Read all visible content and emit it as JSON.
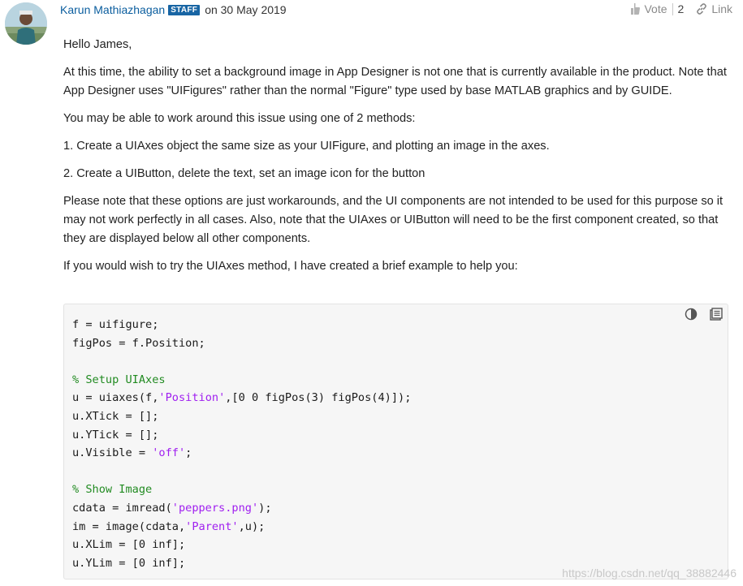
{
  "post": {
    "author": "Karun Mathiazhagan",
    "badge": "STAFF",
    "date": "on 30 May 2019",
    "vote_label": "Vote",
    "vote_count": "2",
    "link_label": "Link"
  },
  "paragraphs": {
    "p1": "Hello James,",
    "p2": "At this time, the ability to set a background image in App Designer is not one that is currently available in the product. Note that App Designer uses \"UIFigures\" rather than the normal \"Figure\" type used by base MATLAB graphics and by GUIDE.",
    "p3": "You may be able to work around this issue using one of 2 methods:",
    "p4": "1. Create a UIAxes object the same size as your UIFigure, and plotting an image in the axes.",
    "p5": "2. Create a UIButton, delete the text, set an image icon for the button",
    "p6": "Please note that these options are just workarounds, and the UI components are not intended to be used for this purpose so it may not work perfectly in all cases. Also, note that the UIAxes or UIButton will need to be the first component created, so that they are displayed below all other components.",
    "p7": "If you would wish to try the UIAxes method, I have created a brief example to help you:"
  },
  "code": {
    "l1": "f = uifigure;",
    "l2": "figPos = f.Position;",
    "l4": "% Setup UIAxes",
    "l5a": "u = uiaxes(f,",
    "l5b": "'Position'",
    "l5c": ",[0 0 figPos(3) figPos(4)]);",
    "l6": "u.XTick = [];",
    "l7": "u.YTick = [];",
    "l8a": "u.Visible = ",
    "l8b": "'off'",
    "l8c": ";",
    "l10": "% Show Image",
    "l11a": "cdata = imread(",
    "l11b": "'peppers.png'",
    "l11c": ");",
    "l12a": "im = image(cdata,",
    "l12b": "'Parent'",
    "l12c": ",u);",
    "l13": "u.XLim = [0 inf];",
    "l14": "u.YLim = [0 inf];"
  },
  "watermark": "https://blog.csdn.net/qq_38882446",
  "icons": {
    "vote": "thumbs-up-icon",
    "link": "link-icon",
    "theme": "contrast-toggle-icon",
    "copy": "copy-code-icon"
  },
  "colors": {
    "author": "#0a5d9e",
    "badge_bg": "#1865a4",
    "code_comment": "#228b22",
    "code_string": "#a020f0",
    "code_bg": "#f6f6f6"
  }
}
